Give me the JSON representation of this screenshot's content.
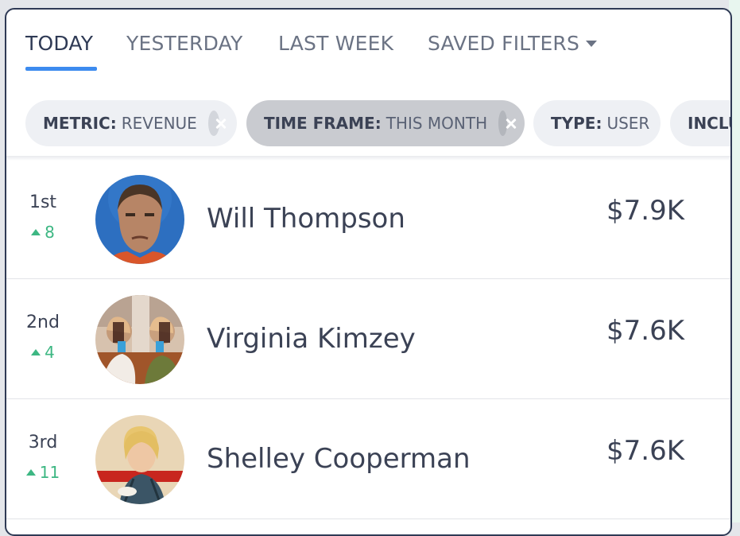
{
  "tabs": [
    {
      "label": "TODAY",
      "active": true
    },
    {
      "label": "YESTERDAY",
      "active": false
    },
    {
      "label": "LAST WEEK",
      "active": false
    },
    {
      "label": "SAVED FILTERS",
      "active": false
    }
  ],
  "filters": [
    {
      "key": "METRIC:",
      "value": "REVENUE",
      "removable": true,
      "selected": false
    },
    {
      "key": "TIME FRAME:",
      "value": "THIS MONTH",
      "removable": true,
      "selected": true
    },
    {
      "key": "TYPE:",
      "value": "USER",
      "removable": false,
      "selected": false
    },
    {
      "key": "INCLU",
      "value": "",
      "removable": false,
      "selected": false
    }
  ],
  "leaderboard": [
    {
      "rank": "1st",
      "delta": "8",
      "name": "Will Thompson",
      "value": "$7.9K"
    },
    {
      "rank": "2nd",
      "delta": "4",
      "name": "Virginia Kimzey",
      "value": "$7.6K"
    },
    {
      "rank": "3rd",
      "delta": "11",
      "name": "Shelley Cooperman",
      "value": "$7.6K"
    }
  ],
  "colors": {
    "accent": "#3d8bef",
    "positive": "#3db783",
    "text": "#3b4255",
    "border": "#2f3a55"
  }
}
